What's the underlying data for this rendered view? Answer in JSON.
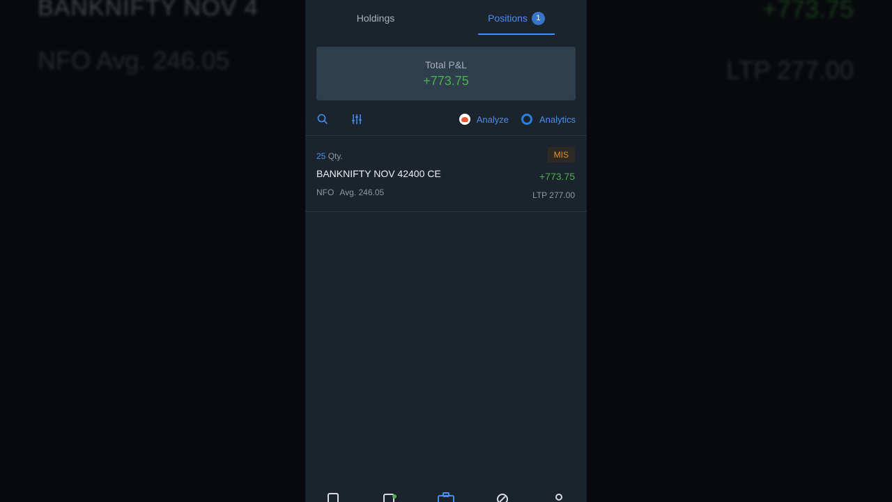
{
  "background": {
    "title": "BANKNIFTY NOV 4",
    "subtitle": "NFO  Avg. 246.05",
    "pnl": "+773.75",
    "ltp": "LTP 277.00"
  },
  "tabs": [
    {
      "label": "Holdings",
      "active": false
    },
    {
      "label": "Positions",
      "active": true,
      "badge": "1"
    }
  ],
  "summary": {
    "label": "Total P&L",
    "value": "+773.75"
  },
  "toolbar": {
    "icons": [
      "search-icon",
      "filter-icon"
    ],
    "analyze_label": "Analyze",
    "analytics_label": "Analytics"
  },
  "positions": [
    {
      "qty": "25",
      "qty_suffix": "Qty.",
      "symbol": "BANKNIFTY NOV 42400 CE",
      "exchange": "NFO",
      "avg": "Avg. 246.05",
      "product": "MIS",
      "pnl": "+773.75",
      "ltp": "LTP 277.00"
    }
  ],
  "bottom_nav": [
    {
      "icon": "watchlist-icon"
    },
    {
      "icon": "orders-icon",
      "dot": true
    },
    {
      "icon": "portfolio-icon",
      "active": true
    },
    {
      "icon": "bids-icon"
    },
    {
      "icon": "profile-icon"
    }
  ],
  "colors": {
    "accent": "#4a8ff0",
    "profit": "#4caf50",
    "product_badge": "#e0922c",
    "panel": "#1b232c"
  }
}
